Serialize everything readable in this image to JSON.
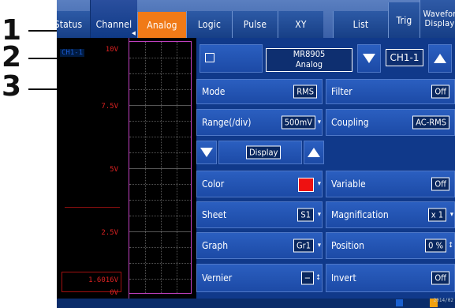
{
  "callouts": {
    "one": "1",
    "two": "2",
    "three": "3"
  },
  "tabs": {
    "status": "Status",
    "channel": "Channel",
    "analog": "Analog",
    "logic": "Logic",
    "pulse": "Pulse",
    "xy": "XY",
    "list": "List",
    "trig": "Trig",
    "waveform": "Wavefor\nDisplay"
  },
  "waveform": {
    "ch_label": "CH1-1",
    "scale": [
      "10V",
      "7.5V",
      "5V",
      "2.5V",
      "1.6016V",
      "0V"
    ]
  },
  "module": {
    "model": "MR8905",
    "type": "Analog",
    "channel": "CH1-1"
  },
  "controls": {
    "mode_label": "Mode",
    "mode_value": "RMS",
    "filter_label": "Filter",
    "filter_value": "Off",
    "range_label": "Range(/div)",
    "range_value": "500mV",
    "coupling_label": "Coupling",
    "coupling_value": "AC-RMS",
    "display_label": "Display",
    "color_label": "Color",
    "variable_label": "Variable",
    "variable_value": "Off",
    "sheet_label": "Sheet",
    "sheet_value": "S1",
    "magnification_label": "Magnification",
    "magnification_value": "x 1",
    "graph_label": "Graph",
    "graph_value": "Gr1",
    "position_label": "Position",
    "position_value": "0 %",
    "vernier_label": "Vernier",
    "vernier_value": "−",
    "invert_label": "Invert",
    "invert_value": "Off"
  },
  "colors": {
    "accent_orange": "#f07a17",
    "trace_red": "#ee1111",
    "panel_blue": "#1c4aa6"
  },
  "status": {
    "date": "2014/02"
  }
}
